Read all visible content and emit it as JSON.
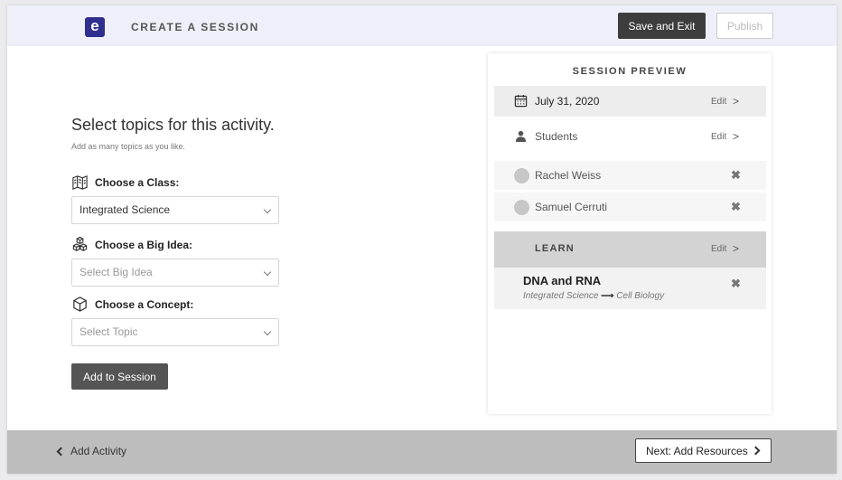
{
  "header": {
    "logo_letter": "e",
    "title": "CREATE A SESSION",
    "save_exit": "Save and Exit",
    "publish": "Publish"
  },
  "main": {
    "title": "Select topics for this activity.",
    "subtitle": "Add as many topics as you like.",
    "class_label": "Choose a Class:",
    "class_value": "Integrated Science",
    "big_idea_label": "Choose a Big Idea:",
    "big_idea_placeholder": "Select Big Idea",
    "concept_label": "Choose a Concept:",
    "concept_placeholder": "Select Topic",
    "add_button": "Add to Session"
  },
  "preview": {
    "title": "SESSION PREVIEW",
    "date": "July 31, 2020",
    "date_edit": "Edit",
    "students_label": "Students",
    "students_edit": "Edit",
    "students": [
      "Rachel Weiss",
      "Samuel Cerruti"
    ],
    "learn_label": "LEARN",
    "learn_edit": "Edit",
    "topic_title": "DNA and RNA",
    "topic_class": "Integrated Science",
    "topic_unit": "Cell Biology",
    "remove_symbol": "✖",
    "arrow_symbol": "⟶"
  },
  "footer": {
    "back": "Add Activity",
    "next": "Next: Add Resources"
  },
  "colors": {
    "brand": "#2f2f8f",
    "header_bg": "#efeff9",
    "footer_bg": "#bdbdbd",
    "primary_button": "#3d3d3d"
  }
}
